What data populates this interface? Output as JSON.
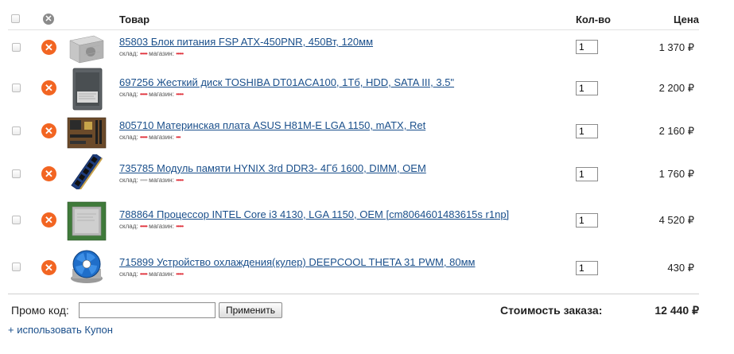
{
  "header": {
    "title": "Товар",
    "qty": "Кол-во",
    "price": "Цена"
  },
  "stock_labels": {
    "warehouse": "склад:",
    "store": "магазин:"
  },
  "items": [
    {
      "name": "85803 Блок питания FSP ATX-450PNR, 450Вт, 120мм",
      "qty": "1",
      "price": "1 370 ₽",
      "warehouse_dots": "•••••",
      "store_dots": "•••••",
      "image": "psu-image"
    },
    {
      "name": "697256 Жесткий диск TOSHIBA DT01ACA100, 1Тб, HDD, SATA III, 3.5\"",
      "qty": "1",
      "price": "2 200 ₽",
      "warehouse_dots": "•••••",
      "store_dots": "•••••",
      "image": "hdd-image"
    },
    {
      "name": "805710 Материнская плата ASUS H81M-E LGA 1150, mATX, Ret",
      "qty": "1",
      "price": "2 160 ₽",
      "warehouse_dots": "•••••",
      "store_dots": "•••",
      "image": "motherboard-image"
    },
    {
      "name": "735785 Модуль памяти HYNIX 3rd DDR3- 4Гб 1600, DIMM, OEM",
      "qty": "1",
      "price": "1 760 ₽",
      "warehouse_dots": "•••••",
      "store_dots": "•••••",
      "image": "ram-image"
    },
    {
      "name": "788864 Процессор INTEL Core i3 4130, LGA 1150, OEM [cm8064601483615s r1np]",
      "qty": "1",
      "price": "4 520 ₽",
      "warehouse_dots": "•••••",
      "store_dots": "•••••",
      "image": "cpu-image"
    },
    {
      "name": "715899 Устройство охлаждения(кулер) DEEPCOOL THETA 31 PWM, 80мм",
      "qty": "1",
      "price": "430 ₽",
      "warehouse_dots": "•••••",
      "store_dots": "•••••",
      "image": "cooler-image"
    }
  ],
  "promo": {
    "label": "Промо код:",
    "value": "",
    "button": "Применить"
  },
  "total": {
    "label": "Стоимость заказа:",
    "value": "12 440 ₽"
  },
  "coupon_link": "+ использовать Купон",
  "colors": {
    "accent": "#f26522",
    "link": "#1a4f8b",
    "stock_dot": "#e0303a"
  }
}
